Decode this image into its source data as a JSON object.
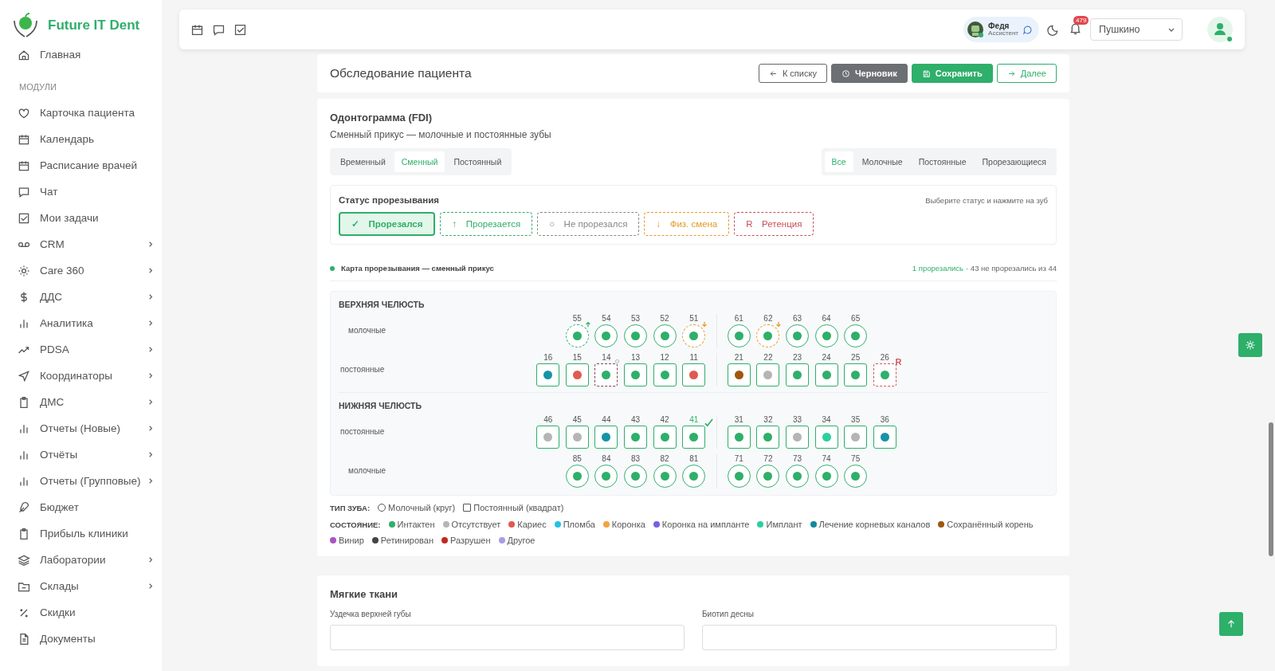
{
  "sidebar": {
    "logo": "Future IT Dent",
    "home": {
      "label": "Главная"
    },
    "section": "МОДУЛИ",
    "items": [
      {
        "label": "Карточка пациента",
        "has_children": false
      },
      {
        "label": "Календарь",
        "has_children": false
      },
      {
        "label": "Расписание врачей",
        "has_children": false
      },
      {
        "label": "Чат",
        "has_children": false
      },
      {
        "label": "Мои задачи",
        "has_children": false
      },
      {
        "label": "CRM",
        "has_children": true
      },
      {
        "label": "Care 360",
        "has_children": true
      },
      {
        "label": "ДДС",
        "has_children": true
      },
      {
        "label": "Аналитика",
        "has_children": true
      },
      {
        "label": "PDSA",
        "has_children": true
      },
      {
        "label": "Координаторы",
        "has_children": true
      },
      {
        "label": "ДМС",
        "has_children": true
      },
      {
        "label": "Отчеты (Новые)",
        "has_children": true
      },
      {
        "label": "Отчёты",
        "has_children": true
      },
      {
        "label": "Отчеты (Групповые)",
        "has_children": true
      },
      {
        "label": "Бюджет",
        "has_children": false
      },
      {
        "label": "Прибыль клиники",
        "has_children": false
      },
      {
        "label": "Лаборатории",
        "has_children": true
      },
      {
        "label": "Склады",
        "has_children": true
      },
      {
        "label": "Скидки",
        "has_children": false
      },
      {
        "label": "Документы",
        "has_children": false
      }
    ]
  },
  "header": {
    "user": {
      "name": "Федя",
      "role": "Ассистент"
    },
    "notifications": "479",
    "branch": "Пушкино"
  },
  "exam": {
    "title": "Обследование пациента",
    "buttons": [
      {
        "label": "К списку",
        "kind": "back"
      },
      {
        "label": "Черновик",
        "kind": "draft"
      },
      {
        "label": "Сохранить",
        "kind": "save"
      },
      {
        "label": "Далее",
        "kind": "next"
      }
    ]
  },
  "odontogram": {
    "title": "Одонтограмма (FDI)",
    "subtitle": "Сменный прикус — молочные и постоянные зубы",
    "dentition_tabs": [
      {
        "label": "Временный",
        "selected": false
      },
      {
        "label": "Сменный",
        "selected": true
      },
      {
        "label": "Постоянный",
        "selected": false
      }
    ],
    "filter_tabs": [
      {
        "label": "Все",
        "selected": true
      },
      {
        "label": "Молочные",
        "selected": false
      },
      {
        "label": "Постоянные",
        "selected": false
      },
      {
        "label": "Прорезающиеся",
        "selected": false
      }
    ],
    "status_panel": {
      "title": "Статус прорезывания",
      "hint": "Выберите статус и нажмите на зуб",
      "options": [
        {
          "icon": "✓",
          "label": "Прорезался",
          "color": "#2eaf6a",
          "selected": true
        },
        {
          "icon": "↑",
          "label": "Прорезается",
          "color": "#2eaf6a",
          "selected": false
        },
        {
          "icon": "○",
          "label": "Не прорезался",
          "color": "#888888",
          "selected": false
        },
        {
          "icon": "↓",
          "label": "Физ. смена",
          "color": "#e39a2a",
          "selected": false
        },
        {
          "icon": "R",
          "label": "Ретенция",
          "color": "#c9505a",
          "selected": false
        }
      ]
    },
    "summary": {
      "title": "Карта прорезывания — сменный прикус",
      "erupted": "1 прорезались",
      "rest": "· 43 не прорезались из 44"
    },
    "jaws": [
      {
        "title": "ВЕРХНЯЯ ЧЕЛЮСТЬ",
        "rows": [
          {
            "label": "молочные",
            "kind": "primary",
            "left": [
              {
                "number": "55",
                "color": "#2eaf6a",
                "kind": "erupting"
              },
              {
                "number": "54",
                "color": "#2eaf6a",
                "kind": "normal"
              },
              {
                "number": "53",
                "color": "#2eaf6a",
                "kind": "normal"
              },
              {
                "number": "52",
                "color": "#2eaf6a",
                "kind": "normal"
              },
              {
                "number": "51",
                "color": "#2eaf6a",
                "kind": "shedding"
              }
            ],
            "right": [
              {
                "number": "61",
                "color": "#2eaf6a",
                "kind": "normal"
              },
              {
                "number": "62",
                "color": "#2eaf6a",
                "kind": "shedding"
              },
              {
                "number": "63",
                "color": "#2eaf6a",
                "kind": "normal"
              },
              {
                "number": "64",
                "color": "#2eaf6a",
                "kind": "normal"
              },
              {
                "number": "65",
                "color": "#2eaf6a",
                "kind": "normal"
              }
            ]
          },
          {
            "label": "постоянные",
            "kind": "permanent",
            "left": [
              {
                "number": "16",
                "color": "#1793a8",
                "kind": "normal"
              },
              {
                "number": "15",
                "color": "#e05a4f",
                "kind": "normal"
              },
              {
                "number": "14",
                "color": "#2eaf6a",
                "kind": "unerupted"
              },
              {
                "number": "13",
                "color": "#2eaf6a",
                "kind": "normal"
              },
              {
                "number": "12",
                "color": "#2eaf6a",
                "kind": "normal"
              },
              {
                "number": "11",
                "color": "#e05a4f",
                "kind": "normal"
              }
            ],
            "right": [
              {
                "number": "21",
                "color": "#a0560f",
                "kind": "normal"
              },
              {
                "number": "22",
                "color": "#b5b5b5",
                "kind": "normal"
              },
              {
                "number": "23",
                "color": "#2eaf6a",
                "kind": "normal"
              },
              {
                "number": "24",
                "color": "#2eaf6a",
                "kind": "normal"
              },
              {
                "number": "25",
                "color": "#2eaf6a",
                "kind": "normal"
              },
              {
                "number": "26",
                "color": "#2eaf6a",
                "kind": "retention",
                "badge": "R"
              }
            ]
          }
        ]
      },
      {
        "title": "НИЖНЯЯ ЧЕЛЮСТЬ",
        "rows": [
          {
            "label": "постоянные",
            "kind": "permanent",
            "left": [
              {
                "number": "46",
                "color": "#b5b5b5",
                "kind": "normal"
              },
              {
                "number": "45",
                "color": "#b5b5b5",
                "kind": "normal"
              },
              {
                "number": "44",
                "color": "#1793a8",
                "kind": "normal"
              },
              {
                "number": "43",
                "color": "#2eaf6a",
                "kind": "normal"
              },
              {
                "number": "42",
                "color": "#2eaf6a",
                "kind": "normal"
              },
              {
                "number": "41",
                "color": "#2eaf6a",
                "kind": "erupted"
              }
            ],
            "right": [
              {
                "number": "31",
                "color": "#2eaf6a",
                "kind": "normal"
              },
              {
                "number": "32",
                "color": "#2eaf6a",
                "kind": "normal"
              },
              {
                "number": "33",
                "color": "#b5b5b5",
                "kind": "normal"
              },
              {
                "number": "34",
                "color": "#2ccf9e",
                "kind": "normal"
              },
              {
                "number": "35",
                "color": "#b5b5b5",
                "kind": "normal"
              },
              {
                "number": "36",
                "color": "#1793a8",
                "kind": "normal"
              }
            ]
          },
          {
            "label": "молочные",
            "kind": "primary",
            "left": [
              {
                "number": "85",
                "color": "#2eaf6a",
                "kind": "normal"
              },
              {
                "number": "84",
                "color": "#2eaf6a",
                "kind": "normal"
              },
              {
                "number": "83",
                "color": "#2eaf6a",
                "kind": "normal"
              },
              {
                "number": "82",
                "color": "#2eaf6a",
                "kind": "normal"
              },
              {
                "number": "81",
                "color": "#2eaf6a",
                "kind": "normal"
              }
            ],
            "right": [
              {
                "number": "71",
                "color": "#2eaf6a",
                "kind": "normal"
              },
              {
                "number": "72",
                "color": "#2eaf6a",
                "kind": "normal"
              },
              {
                "number": "73",
                "color": "#2eaf6a",
                "kind": "normal"
              },
              {
                "number": "74",
                "color": "#2eaf6a",
                "kind": "normal"
              },
              {
                "number": "75",
                "color": "#2eaf6a",
                "kind": "normal"
              }
            ]
          }
        ]
      }
    ],
    "type_legend": {
      "title": "ТИП ЗУБА:",
      "items": [
        {
          "label": "Молочный (круг)",
          "kind": "primary"
        },
        {
          "label": "Постоянный (квадрат)",
          "kind": "permanent"
        }
      ]
    },
    "state_legend": {
      "title": "СОСТОЯНИЕ:",
      "items": [
        {
          "label": "Интактен",
          "color": "#2eaf6a"
        },
        {
          "label": "Отсутствует",
          "color": "#b5b5b5"
        },
        {
          "label": "Кариес",
          "color": "#e05a4f"
        },
        {
          "label": "Пломба",
          "color": "#22c3e6"
        },
        {
          "label": "Коронка",
          "color": "#f4a340"
        },
        {
          "label": "Коронка на импланте",
          "color": "#7b5ce6"
        },
        {
          "label": "Имплант",
          "color": "#2ccfa0"
        },
        {
          "label": "Лечение корневых каналов",
          "color": "#13899a"
        },
        {
          "label": "Сохранённый корень",
          "color": "#a0560f"
        },
        {
          "label": "Винир",
          "color": "#a855c7"
        },
        {
          "label": "Ретинирован",
          "color": "#444444"
        },
        {
          "label": "Разрушен",
          "color": "#c0281f"
        },
        {
          "label": "Другое",
          "color": "#a99be8"
        }
      ]
    }
  },
  "soft_tissue": {
    "title": "Мягкие ткани",
    "fields": [
      {
        "label": "Уздечка верхней губы"
      },
      {
        "label": "Биотип десны"
      }
    ]
  }
}
